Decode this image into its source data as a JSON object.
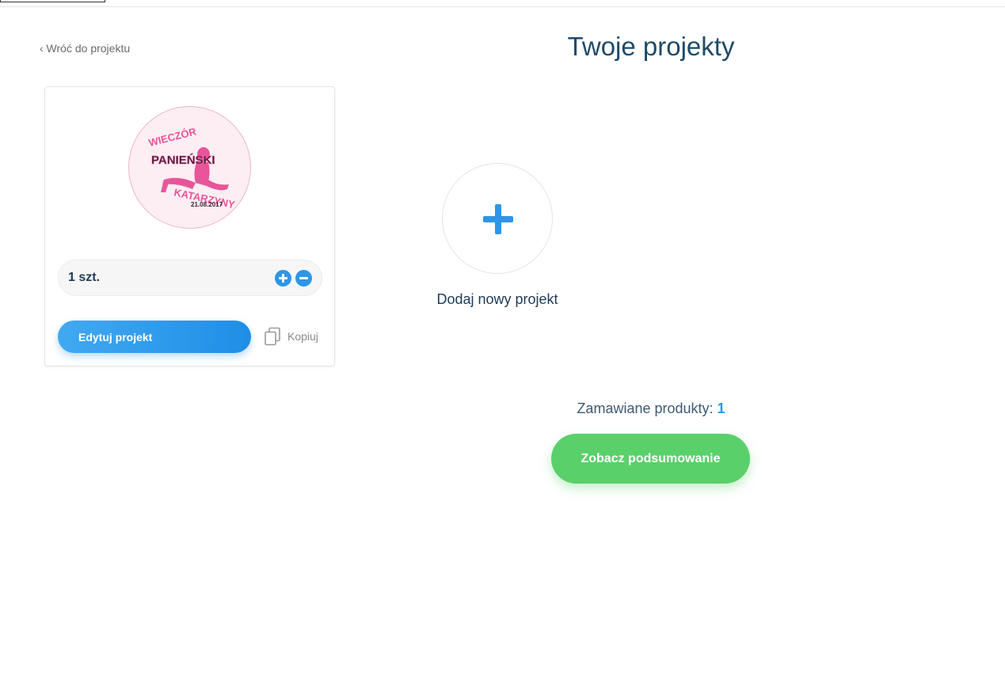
{
  "back_link": "‹ Wróć do projektu",
  "page_title": "Twoje projekty",
  "project_card": {
    "thumbnail": {
      "line1": "WIECZÓR",
      "line2": "PANIEŃSKI",
      "line3": "KATARZYNY",
      "date": "21.08.2017"
    },
    "quantity_label": "1 szt.",
    "edit_label": "Edytuj projekt",
    "copy_label": "Kopiuj"
  },
  "add_project": {
    "label": "Dodaj nowy projekt"
  },
  "summary": {
    "label": "Zamawiane produkty:",
    "count": "1",
    "button_label": "Zobacz podsumowanie"
  },
  "colors": {
    "accent_blue": "#2e96e6",
    "title_navy": "#1f4a68",
    "summary_green": "#5ad06a",
    "thumb_pink": "#e8559a"
  }
}
